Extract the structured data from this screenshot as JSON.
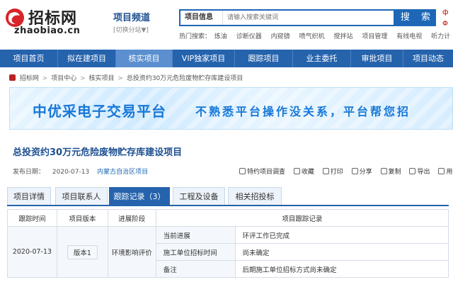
{
  "logo": {
    "cn": "招标网",
    "en": "zhaobiao.cn"
  },
  "channel": {
    "title": "项目频道",
    "switch": "[切换分站▼]"
  },
  "search": {
    "category": "项目信息",
    "placeholder": "请输入搜索关键词",
    "button": "搜 索",
    "hot_label": "热门搜索：",
    "hot": [
      "炼油",
      "诊断仪器",
      "内窥镜",
      "喷气织机",
      "搅拌站",
      "项目管理",
      "有线电视",
      "听力计"
    ]
  },
  "edge": {
    "top": "ф",
    "mid": "Φ"
  },
  "nav": [
    "项目首页",
    "拟在建项目",
    "核实项目",
    "VIP独家项目",
    "跟踪项目",
    "业主委托",
    "审批项目",
    "项目动态"
  ],
  "nav_active": "核实项目",
  "breadcrumb": [
    "招标网",
    "项目中心",
    "核实项目",
    "总投资约30万元危险废物贮存库建设项目"
  ],
  "banner": {
    "left": "中优采电子交易平台",
    "right": "不熟悉平台操作没关系，平台帮您招"
  },
  "page_title": "总投资约30万元危险废物贮存库建设项目",
  "meta": {
    "label": "发布日期：",
    "date": "2020-07-13",
    "region": "内蒙古自治区项目"
  },
  "tools": [
    "特约项目调查",
    "收藏",
    "打印",
    "分享",
    "复制",
    "导出",
    "用手机查看"
  ],
  "tabs": [
    "项目详情",
    "项目联系人",
    "跟踪记录（3）",
    "工程及设备",
    "相关招投标"
  ],
  "tab_active": "跟踪记录（3）",
  "table": {
    "headers": [
      "跟踪时间",
      "项目版本",
      "进展阶段",
      "项目跟踪记录"
    ],
    "date": "2020-07-13",
    "version": "版本1",
    "stage": "环境影响评价",
    "rows": [
      {
        "key": "当前进展",
        "value": "环评工作已完成"
      },
      {
        "key": "施工单位招标时间",
        "value": "尚未确定"
      },
      {
        "key": "备注",
        "value": "后期施工单位招标方式尚未确定"
      }
    ]
  }
}
